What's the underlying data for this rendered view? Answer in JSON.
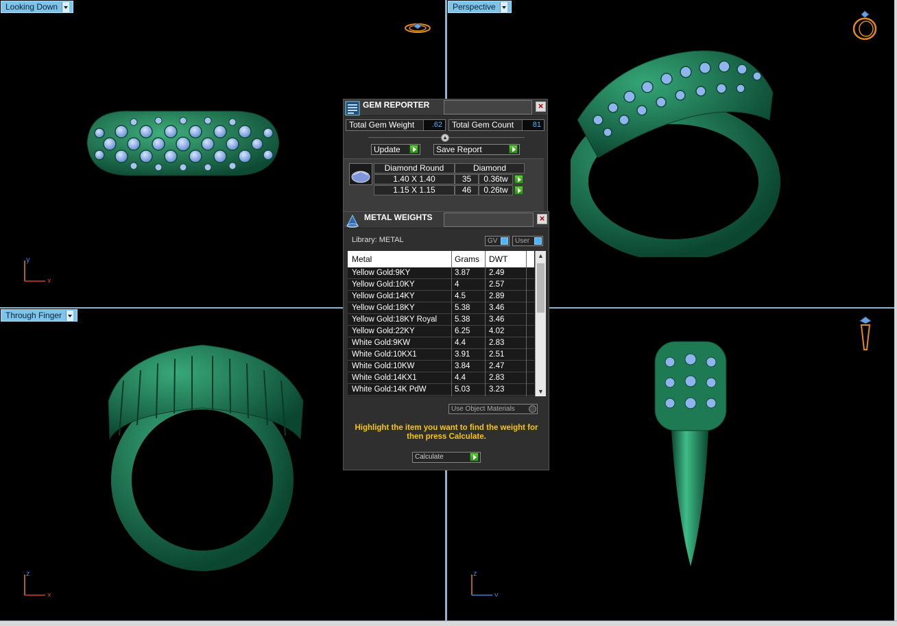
{
  "viewports": {
    "top_left": {
      "label": "Looking Down",
      "axes": [
        "y",
        "x"
      ]
    },
    "top_right": {
      "label": "Perspective"
    },
    "bottom_left": {
      "label": "Through Finger",
      "axes": [
        "z",
        "x"
      ]
    },
    "bottom_right": {
      "axes": [
        "z",
        "y"
      ]
    }
  },
  "gem_reporter": {
    "title": "GEM REPORTER",
    "total_weight_label": "Total Gem Weight",
    "total_weight_value": ".62",
    "total_count_label": "Total Gem Count",
    "total_count_value": "81",
    "update_label": "Update",
    "save_report_label": "Save Report",
    "stone_shape": "Diamond Round",
    "stone_material": "Diamond",
    "rows": [
      {
        "size": "1.40 X 1.40",
        "count": "35",
        "weight": "0.36tw"
      },
      {
        "size": "1.15 X 1.15",
        "count": "46",
        "weight": "0.26tw"
      }
    ]
  },
  "metal_weights": {
    "title": "METAL WEIGHTS",
    "library_label": "Library: METAL",
    "gv_label": "GV",
    "user_label": "User",
    "columns": [
      "Metal",
      "Grams",
      "DWT"
    ],
    "rows": [
      {
        "metal": "Yellow Gold:9KY",
        "grams": "3.87",
        "dwt": "2.49"
      },
      {
        "metal": "Yellow Gold:10KY",
        "grams": "4",
        "dwt": "2.57"
      },
      {
        "metal": "Yellow Gold:14KY",
        "grams": "4.5",
        "dwt": "2.89"
      },
      {
        "metal": "Yellow Gold:18KY",
        "grams": "5.38",
        "dwt": "3.46"
      },
      {
        "metal": "Yellow Gold:18KY Royal",
        "grams": "5.38",
        "dwt": "3.46"
      },
      {
        "metal": "Yellow Gold:22KY",
        "grams": "6.25",
        "dwt": "4.02"
      },
      {
        "metal": "White Gold:9KW",
        "grams": "4.4",
        "dwt": "2.83"
      },
      {
        "metal": "White Gold:10KX1",
        "grams": "3.91",
        "dwt": "2.51"
      },
      {
        "metal": "White Gold:10KW",
        "grams": "3.84",
        "dwt": "2.47"
      },
      {
        "metal": "White Gold:14KX1",
        "grams": "4.4",
        "dwt": "2.83"
      },
      {
        "metal": "White Gold:14K PdW",
        "grams": "5.03",
        "dwt": "3.23"
      }
    ],
    "use_object_materials_label": "Use Object Materials",
    "instruction": "Highlight the item you want to find the weight for then press Calculate.",
    "calculate_label": "Calculate"
  },
  "colors": {
    "viewport_bg": "#000000",
    "label_bg": "#7ec3e8",
    "ring_green": "#1f7a55",
    "gem_blue": "#8fb4ee",
    "gizmo_orange": "#e58a1f",
    "instruction_yellow": "#f5c518",
    "axis_orange": "#e0852a",
    "axis_red": "#d83a2a",
    "axis_blue": "#3a7fd8"
  }
}
